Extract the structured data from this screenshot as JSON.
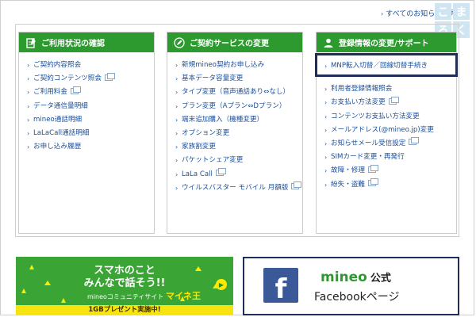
{
  "top_link": {
    "label": "すべてのお知らせを見る"
  },
  "side_badge": {
    "chars": [
      "こ",
      "ま",
      "ろ",
      "く"
    ]
  },
  "panels": [
    {
      "title": "ご利用状況の確認",
      "icon": "clipboard-icon",
      "items": [
        {
          "label": "ご契約内容照会",
          "external": false
        },
        {
          "label": "ご契約コンテンツ照会",
          "external": true
        },
        {
          "label": "ご利用料金",
          "external": true
        },
        {
          "label": "データ通信量明細",
          "external": false
        },
        {
          "label": "mineo通話明細",
          "external": false
        },
        {
          "label": "LaLaCall通話明細",
          "external": false
        },
        {
          "label": "お申し込み履歴",
          "external": false
        }
      ]
    },
    {
      "title": "ご契約サービスの変更",
      "icon": "pencil-icon",
      "items": [
        {
          "label": "新規mineo契約お申し込み",
          "external": false
        },
        {
          "label": "基本データ容量変更",
          "external": false
        },
        {
          "label": "タイプ変更（音声通話あり⇔なし）",
          "external": false
        },
        {
          "label": "プラン変更（Aプラン⇔Dプラン）",
          "external": false
        },
        {
          "label": "端末追加購入（機種変更）",
          "external": false
        },
        {
          "label": "オプション変更",
          "external": false
        },
        {
          "label": "家族割変更",
          "external": false
        },
        {
          "label": "パケットシェア変更",
          "external": false
        },
        {
          "label": "LaLa Call",
          "external": true
        },
        {
          "label": "ウイルスバスター モバイル 月額版",
          "external": true
        }
      ]
    },
    {
      "title": "登録情報の変更/サポート",
      "icon": "person-icon",
      "items": [
        {
          "label": "MNP転入切替／回線切替手続き",
          "external": false
        },
        {
          "label": "利用者登録情報照会",
          "external": false
        },
        {
          "label": "お支払い方法変更",
          "external": true
        },
        {
          "label": "コンテンツお支払い方法変更",
          "external": false
        },
        {
          "label": "メールアドレス(@mineo.jp)変更",
          "external": false
        },
        {
          "label": "お知らせメール受信設定",
          "external": true
        },
        {
          "label": "SIMカード変更・再発行",
          "external": false
        },
        {
          "label": "故障・修理",
          "external": true
        },
        {
          "label": "紛失・盗難",
          "external": true
        }
      ]
    }
  ],
  "banner_community": {
    "line1": "スマホのこと",
    "line2": "みんなで話そう!!",
    "brand_prefix": "mineoコミュニティサイト",
    "brand_name": "マイネ王",
    "strip": "1GBプレゼント実施中!"
  },
  "banner_facebook": {
    "brand": "mineo",
    "official": "公式",
    "sub": "Facebookページ",
    "logo_letter": "f"
  },
  "colors": {
    "accent_green": "#2d9a2f",
    "link_blue": "#1a4f9c",
    "highlight_navy": "#1e2d5a",
    "facebook_blue": "#3b5998"
  }
}
